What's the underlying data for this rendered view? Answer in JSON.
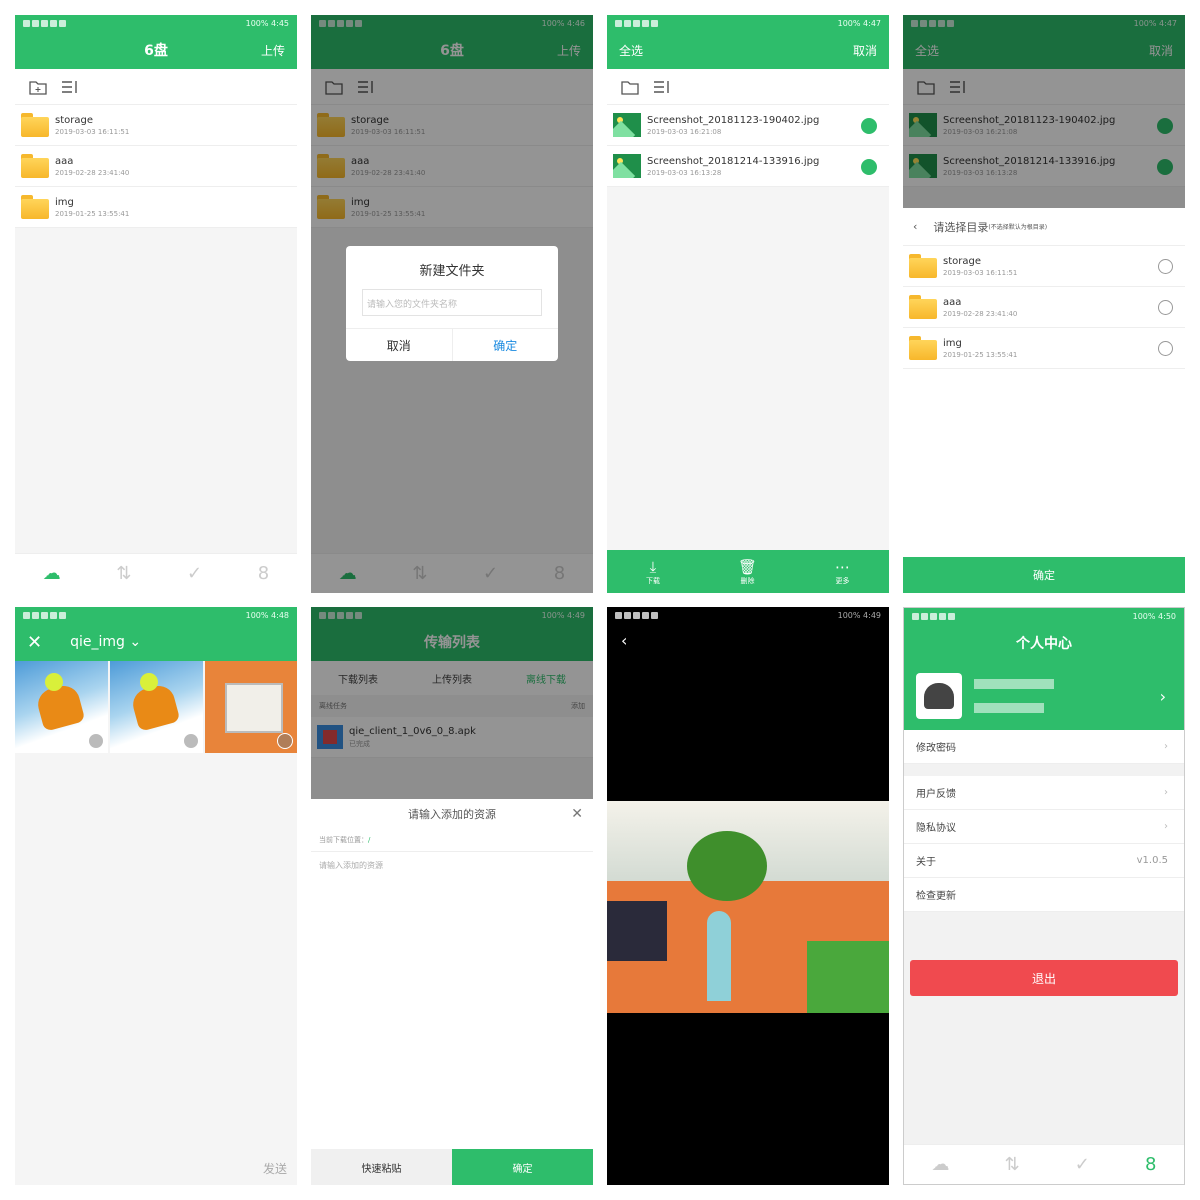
{
  "status": {
    "battery": "100%"
  },
  "s1": {
    "title": "6盘",
    "upload": "上传",
    "time": "4:45",
    "files": [
      {
        "name": "storage",
        "date": "2019-03-03 16:11:51"
      },
      {
        "name": "aaa",
        "date": "2019-02-28 23:41:40"
      },
      {
        "name": "img",
        "date": "2019-01-25 13:55:41"
      }
    ]
  },
  "s2": {
    "title": "6盘",
    "upload": "上传",
    "time": "4:46",
    "dialog_title": "新建文件夹",
    "dialog_placeholder": "请输入您的文件夹名称",
    "cancel": "取消",
    "ok": "确定"
  },
  "s3": {
    "select_all": "全选",
    "cancel": "取消",
    "time": "4:47",
    "files": [
      {
        "name": "Screenshot_20181123-190402.jpg",
        "date": "2019-03-03 16:21:08"
      },
      {
        "name": "Screenshot_20181214-133916.jpg",
        "date": "2019-03-03 16:13:28"
      }
    ],
    "actions": [
      "下载",
      "删除",
      "更多"
    ]
  },
  "s4": {
    "select_all": "全选",
    "cancel": "取消",
    "time": "4:47",
    "choose": "请选择目录",
    "choose_note": "(不选择默认为根目录)",
    "ok": "确定"
  },
  "s5": {
    "album": "qie_img",
    "send": "发送",
    "time": "4:48"
  },
  "s6": {
    "title": "传输列表",
    "time": "4:49",
    "tabs": [
      "下载列表",
      "上传列表",
      "离线下载"
    ],
    "section": "离线任务",
    "add": "添加",
    "task": {
      "name": "qie_client_1_0v6_0_8.apk",
      "state": "已完成"
    },
    "sheet_title": "请输入添加的资源",
    "loc_label": "当前下载位置：",
    "loc_value": "/",
    "input_placeholder": "请输入添加的资源",
    "paste": "快速粘贴",
    "ok": "确定"
  },
  "s7": {
    "time": "4:49"
  },
  "s8": {
    "title": "个人中心",
    "time": "4:50",
    "menu": [
      "修改密码",
      "用户反馈",
      "隐私协议",
      "关于",
      "检查更新"
    ],
    "version": "v1.0.5",
    "logout": "退出"
  }
}
